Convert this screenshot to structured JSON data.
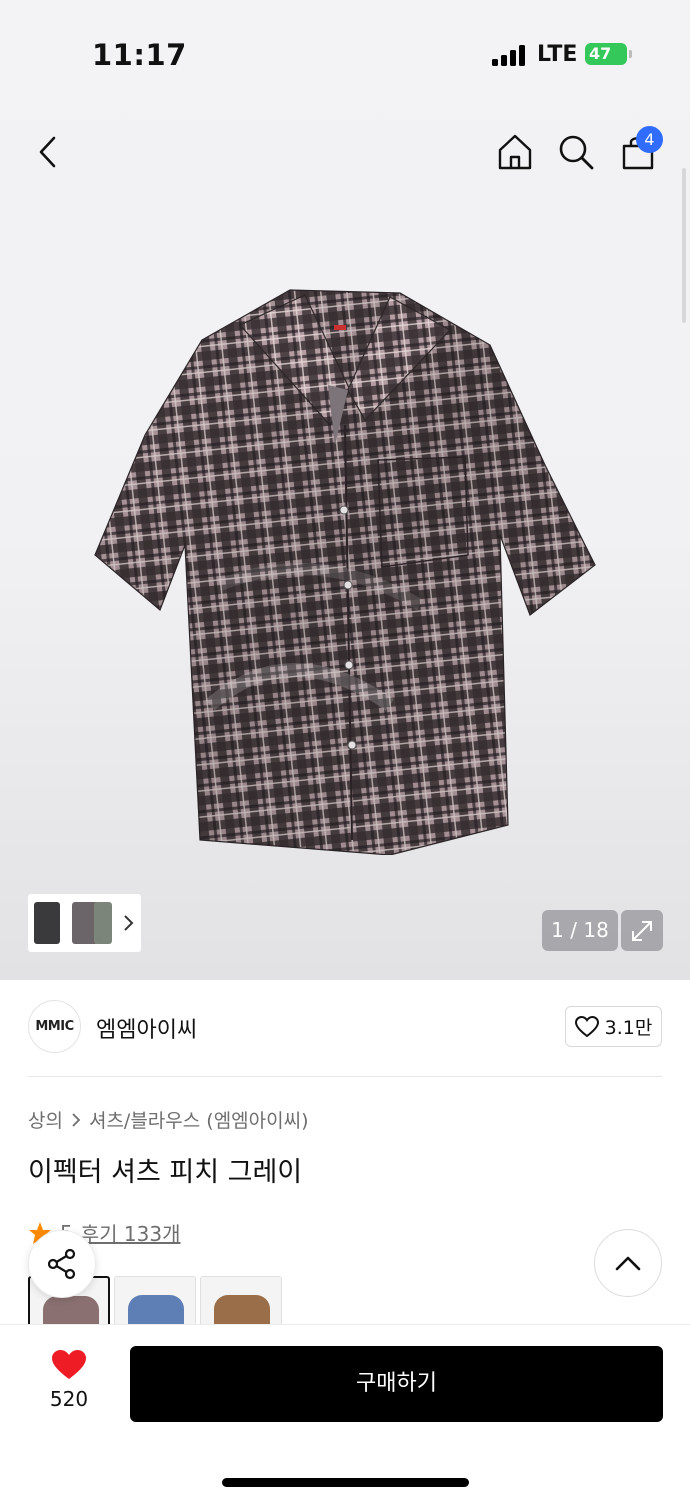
{
  "status_bar": {
    "time": "11:17",
    "network": "LTE",
    "battery": "47"
  },
  "nav": {
    "cart_count": "4"
  },
  "gallery": {
    "counter": "1 / 18"
  },
  "brand": {
    "logo_text": "MMIC",
    "name": "엠엠아이씨",
    "likes": "3.1만"
  },
  "breadcrumb": {
    "category": "상의",
    "subcategory": "셔츠/블라우스 (엠엠아이씨)"
  },
  "product": {
    "title": "이펙터 셔츠 피치 그레이"
  },
  "rating": {
    "score": "5",
    "reviews": "후기 133개"
  },
  "swatches": [
    {
      "name": "pink-gray-check",
      "color": "#8a7070"
    },
    {
      "name": "blue-check",
      "color": "#5d7fb5"
    },
    {
      "name": "brown-check",
      "color": "#9a6e48"
    }
  ],
  "bottom_bar": {
    "wish_count": "520",
    "buy_label": "구매하기"
  },
  "colors": {
    "accent_blue": "#2f6cff",
    "heart_red": "#ee1c25",
    "star_orange": "#ff8a00",
    "battery_green": "#34c759"
  }
}
